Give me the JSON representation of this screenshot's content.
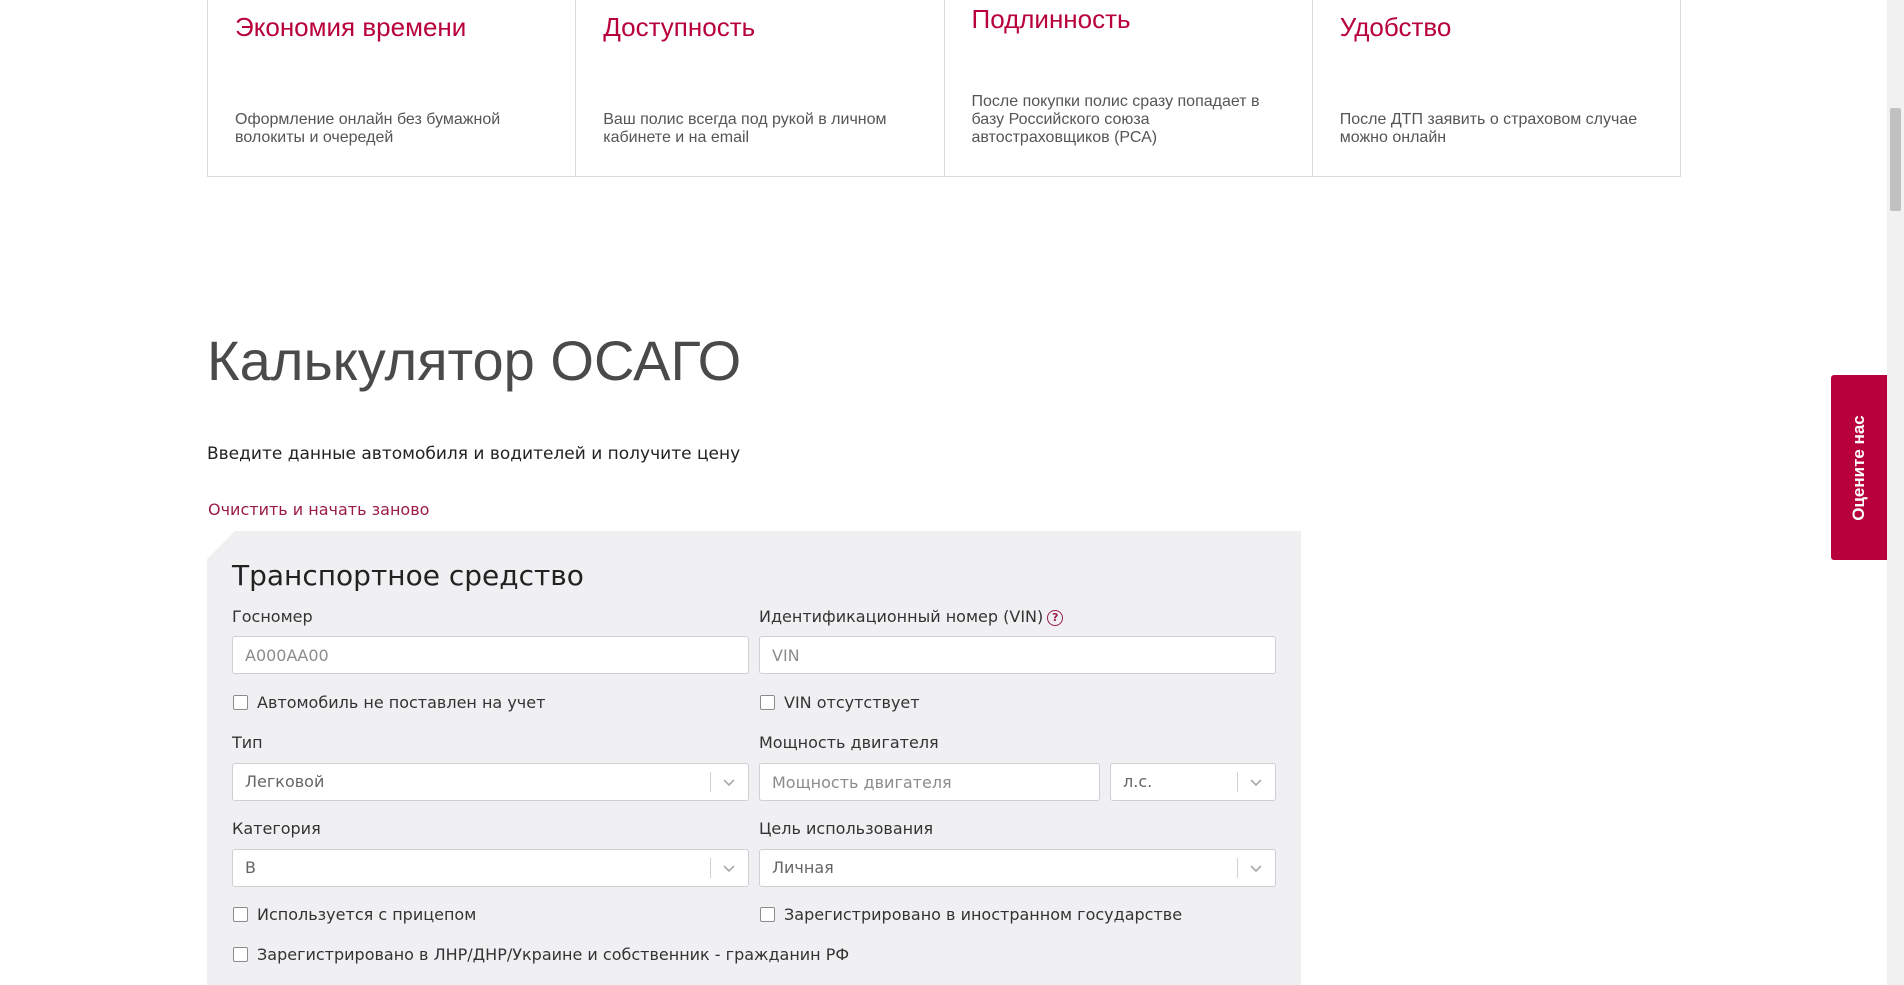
{
  "benefits": [
    {
      "title": "Экономия времени",
      "text": "Оформление онлайн без бумажной волокиты и очередей"
    },
    {
      "title": "Доступность",
      "text": "Ваш полис всегда под рукой в личном кабинете и на email"
    },
    {
      "title": "Подлинность",
      "text": "После покупки полис сразу попадает в базу Российского союза автостраховщиков (РСА)"
    },
    {
      "title": "Удобство",
      "text": "После ДТП заявить о страховом случае можно онлайн"
    }
  ],
  "calculator": {
    "title": "Калькулятор ОСАГО",
    "subtitle": "Введите данные автомобиля и водителей и получите цену",
    "reset_link": "Очистить и начать заново"
  },
  "vehicle": {
    "section_title": "Транспортное средство",
    "plate": {
      "label": "Госномер",
      "placeholder": "А000АА00"
    },
    "vin": {
      "label": "Идентификационный номер (VIN)",
      "help_symbol": "?",
      "placeholder": "VIN"
    },
    "not_registered_label": "Автомобиль не поставлен на учет",
    "no_vin_label": "VIN отсутствует",
    "type": {
      "label": "Тип",
      "value": "Легковой"
    },
    "power": {
      "label": "Мощность двигателя",
      "placeholder": "Мощность двигателя",
      "unit_value": "л.с."
    },
    "category": {
      "label": "Категория",
      "value": "B"
    },
    "purpose": {
      "label": "Цель использования",
      "value": "Личная"
    },
    "trailer_label": "Используется с прицепом",
    "foreign_label": "Зарегистрировано в иностранном государстве",
    "lnr_label": "Зарегистрировано в ЛНР/ДНР/Украине и собственник - гражданин РФ"
  },
  "feedback_tab": "Оцените нас",
  "colors": {
    "accent": "#b8003a",
    "link": "#9b1b48",
    "panel_bg": "#f0f0f2"
  },
  "icons": {
    "chevron": "chevron-down-icon",
    "help": "question-circle-icon"
  }
}
